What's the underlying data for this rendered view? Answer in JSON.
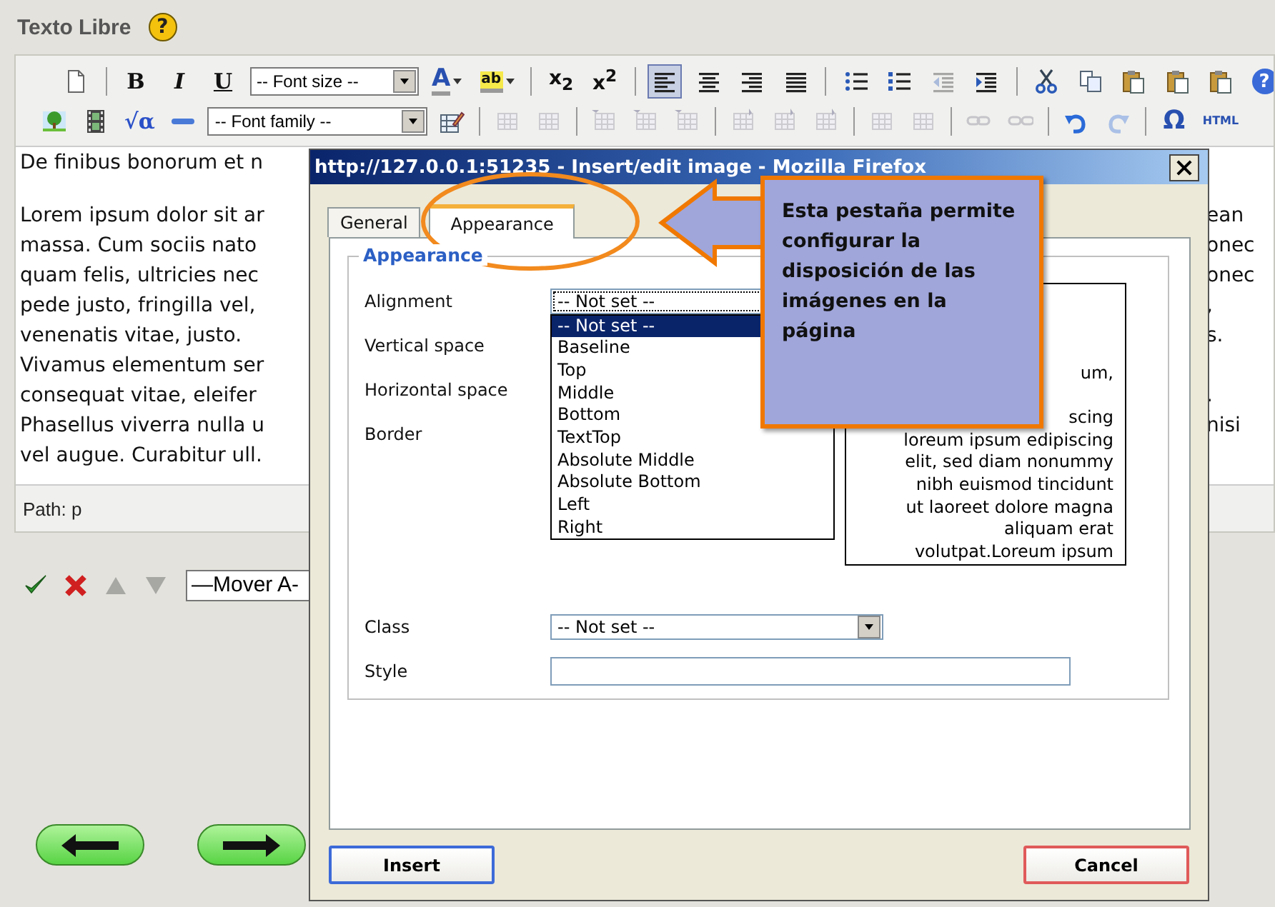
{
  "header": {
    "title": "Texto Libre",
    "help_glyph": "?"
  },
  "toolbar": {
    "rows": [
      [
        {
          "kind": "page",
          "disabled": false,
          "pressed": false
        },
        {
          "kind": "separator"
        },
        {
          "kind": "bold",
          "glyph": "B",
          "disabled": false,
          "pressed": false
        },
        {
          "kind": "italic",
          "glyph": "I",
          "disabled": false,
          "pressed": false
        },
        {
          "kind": "underline",
          "glyph": "U",
          "disabled": false,
          "pressed": false
        },
        {
          "kind": "select",
          "value": "-- Font size --"
        },
        {
          "kind": "text-color",
          "glyph": "A",
          "menu": true,
          "disabled": false,
          "pressed": false
        },
        {
          "kind": "highlighter",
          "glyph": "ab",
          "menu": true,
          "disabled": false,
          "pressed": false
        },
        {
          "kind": "separator"
        },
        {
          "kind": "subscript",
          "glyph": "x$_{2}$",
          "disabled": false,
          "pressed": false
        },
        {
          "kind": "superscript",
          "glyph": "x$^{2}$",
          "disabled": false,
          "pressed": false
        },
        {
          "kind": "separator"
        },
        {
          "kind": "align-left",
          "disabled": false,
          "pressed": true
        },
        {
          "kind": "align-center",
          "disabled": false,
          "pressed": false
        },
        {
          "kind": "align-right",
          "disabled": false,
          "pressed": false
        },
        {
          "kind": "justify",
          "disabled": false,
          "pressed": false
        },
        {
          "kind": "separator"
        },
        {
          "kind": "bullet-list",
          "disabled": false,
          "pressed": false
        },
        {
          "kind": "numbered-list",
          "disabled": false,
          "pressed": false
        },
        {
          "kind": "outdent",
          "disabled": true,
          "pressed": false
        },
        {
          "kind": "indent",
          "disabled": false,
          "pressed": false
        },
        {
          "kind": "separator"
        },
        {
          "kind": "scissors",
          "disabled": false,
          "pressed": false
        },
        {
          "kind": "copy",
          "disabled": false,
          "pressed": false
        },
        {
          "kind": "clipboard",
          "disabled": false,
          "pressed": false
        },
        {
          "kind": "clipboard",
          "disabled": false,
          "pressed": false
        },
        {
          "kind": "clipboard",
          "disabled": false,
          "pressed": false
        },
        {
          "kind": "help",
          "glyph": "?",
          "disabled": false,
          "pressed": false
        }
      ],
      [
        {
          "kind": "picture",
          "disabled": false,
          "pressed": false
        },
        {
          "kind": "film",
          "disabled": false,
          "pressed": false
        },
        {
          "kind": "math",
          "glyph": "√α",
          "disabled": false,
          "pressed": false
        },
        {
          "kind": "rule",
          "disabled": false,
          "pressed": false
        },
        {
          "kind": "select",
          "value": "-- Font family --"
        },
        {
          "kind": "table-pencil",
          "disabled": false,
          "pressed": false
        },
        {
          "kind": "separator"
        },
        {
          "kind": "table",
          "disabled": true,
          "pressed": false
        },
        {
          "kind": "table",
          "disabled": true,
          "pressed": false
        },
        {
          "kind": "separator"
        },
        {
          "kind": "table-insert",
          "disabled": true,
          "pressed": false
        },
        {
          "kind": "table-insert",
          "disabled": true,
          "pressed": false
        },
        {
          "kind": "table-insert",
          "disabled": true,
          "pressed": false
        },
        {
          "kind": "separator"
        },
        {
          "kind": "column-insert",
          "disabled": true,
          "pressed": false
        },
        {
          "kind": "column-insert",
          "disabled": true,
          "pressed": false
        },
        {
          "kind": "column-insert",
          "disabled": true,
          "pressed": false
        },
        {
          "kind": "separator"
        },
        {
          "kind": "table",
          "disabled": true,
          "pressed": false
        },
        {
          "kind": "table",
          "disabled": true,
          "pressed": false
        },
        {
          "kind": "separator"
        },
        {
          "kind": "link",
          "disabled": true,
          "pressed": false
        },
        {
          "kind": "unlink",
          "disabled": true,
          "pressed": false
        },
        {
          "kind": "separator"
        },
        {
          "kind": "undo",
          "disabled": false,
          "pressed": false
        },
        {
          "kind": "redo",
          "disabled": true,
          "pressed": false
        },
        {
          "kind": "separator"
        },
        {
          "kind": "omega",
          "glyph": "Ω",
          "disabled": false,
          "pressed": false
        },
        {
          "kind": "html",
          "glyph": "HTML",
          "disabled": false,
          "pressed": false
        }
      ]
    ]
  },
  "editor": {
    "paragraphs": [
      [
        {
          "left": "De finibus bonorum et n"
        }
      ],
      [
        {
          "left": "Lorem ipsum dolor sit ar",
          "right": "ean"
        },
        {
          "left": "massa. Cum sociis nato",
          "right": "onec"
        },
        {
          "left": "quam felis, ultricies nec",
          "right": "onec"
        },
        {
          "left": "pede justo, fringilla vel,",
          "right": ","
        },
        {
          "left": "venenatis vitae, justo.",
          "right": "s."
        },
        {
          "left": "Vivamus elementum ser"
        },
        {
          "left": "consequat vitae, eleifer",
          "right": "."
        },
        {
          "left": "Phasellus viverra nulla u",
          "right": "nisi"
        },
        {
          "left": "vel augue. Curabitur ull."
        }
      ]
    ],
    "path": "Path: p"
  },
  "actions": [
    {
      "kind": "check",
      "disabled": false
    },
    {
      "kind": "cross",
      "disabled": false
    },
    {
      "kind": "up",
      "disabled": true
    },
    {
      "kind": "down",
      "disabled": true
    }
  ],
  "move_select": {
    "value": "—Mover A-"
  },
  "nav": [
    {
      "kind": "back"
    },
    {
      "kind": "forward"
    }
  ],
  "dialog": {
    "title": "http://127.0.0.1:51235 - Insert/edit image - Mozilla Firefox",
    "tabs": [
      {
        "label": "General",
        "selected": false
      },
      {
        "label": "Appearance",
        "selected": true
      }
    ],
    "legend": "Appearance",
    "fields": [
      {
        "label": "Alignment",
        "kind": "select",
        "value": "-- Not set --",
        "expanded": true,
        "options": [
          {
            "label": "-- Not set --",
            "selected": true
          },
          {
            "label": "Baseline",
            "selected": false
          },
          {
            "label": "Top",
            "selected": false
          },
          {
            "label": "Middle",
            "selected": false
          },
          {
            "label": "Bottom",
            "selected": false
          },
          {
            "label": "TextTop",
            "selected": false
          },
          {
            "label": "Absolute Middle",
            "selected": false
          },
          {
            "label": "Absolute Bottom",
            "selected": false
          },
          {
            "label": "Left",
            "selected": false
          },
          {
            "label": "Right",
            "selected": false
          }
        ]
      },
      {
        "label": "Vertical space"
      },
      {
        "label": "Horizontal space"
      },
      {
        "label": "Border"
      }
    ],
    "preview": [
      [
        "um,"
      ],
      [
        "scing",
        "loreum ipsum edipiscing",
        "elit, sed diam nonummy",
        "nibh euismod tincidunt",
        "ut laoreet dolore magna",
        "aliquam erat",
        "volutpat.Loreum ipsum"
      ]
    ],
    "extra_fields": [
      {
        "label": "Class",
        "kind": "select",
        "value": "-- Not set --",
        "expanded": false
      },
      {
        "label": "Style",
        "kind": "text"
      }
    ],
    "buttons": [
      {
        "label": "Insert",
        "kind": "primary"
      },
      {
        "label": "Cancel",
        "kind": "cancel"
      }
    ]
  },
  "callout": {
    "text": "Esta pestaña permite configurar la disposición de las imágenes en la página"
  }
}
